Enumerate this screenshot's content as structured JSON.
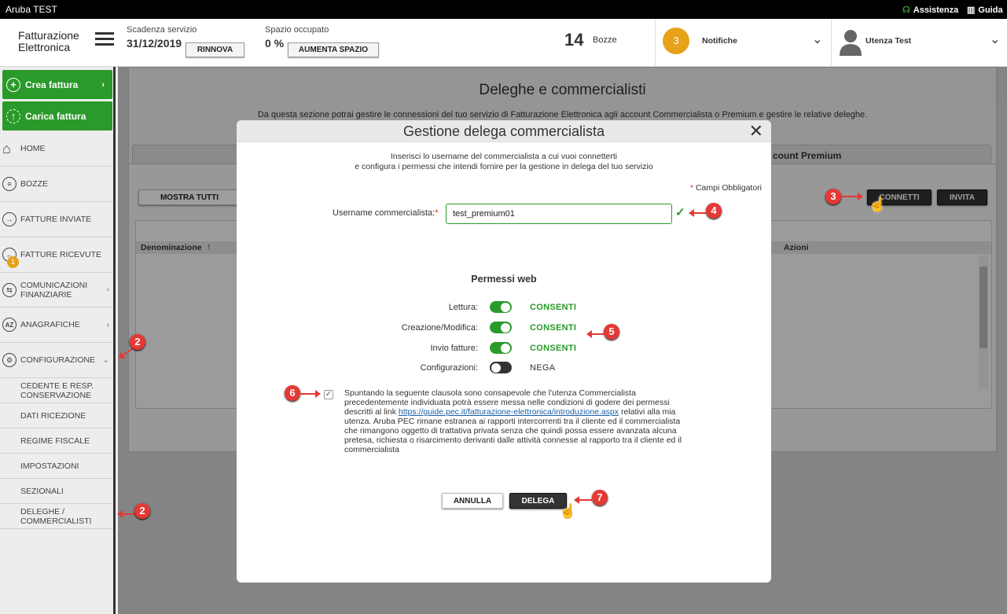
{
  "topbar": {
    "title": "Aruba TEST",
    "assistenza": "Assistenza",
    "guida": "Guida"
  },
  "header": {
    "logo_line1": "Fatturazione",
    "logo_line2": "Elettronica",
    "scadenza_label": "Scadenza servizio",
    "scadenza_value": "31/12/2019",
    "rinnova_label": "RINNOVA",
    "spazio_label": "Spazio occupato",
    "spazio_value": "0 %",
    "aumenta_label": "AUMENTA SPAZIO",
    "bozze_count": "14",
    "bozze_label": "Bozze",
    "notifiche_count": "3",
    "notifiche_label": "Notifiche",
    "user_label": "Utenza Test"
  },
  "sidebar": {
    "crea": "Crea fattura",
    "carica": "Carica fattura",
    "items": [
      {
        "label": "HOME"
      },
      {
        "label": "BOZZE"
      },
      {
        "label": "FATTURE INVIATE"
      },
      {
        "label": "FATTURE RICEVUTE",
        "badge": "1"
      },
      {
        "label": "COMUNICAZIONI FINANZIARIE"
      },
      {
        "label": "ANAGRAFICHE"
      },
      {
        "label": "CONFIGURAZIONE"
      }
    ],
    "subitems": [
      {
        "label": "CEDENTE E RESP. CONSERVAZIONE"
      },
      {
        "label": "DATI RICEZIONE"
      },
      {
        "label": "REGIME FISCALE"
      },
      {
        "label": "IMPOSTAZIONI"
      },
      {
        "label": "SEZIONALI"
      },
      {
        "label": "DELEGHE / COMMERCIALISTI"
      }
    ]
  },
  "page": {
    "title": "Deleghe e commercialisti",
    "description": "Da questa sezione potrai gestire le connessioni del tuo servizio di Fatturazione Elettronica agli account Commercialista o Premium e gestire le relative deleghe.",
    "tab_right": "count Premium",
    "mostra_tutti": "MOSTRA TUTTI",
    "connetti": "CONNETTI",
    "invita": "INVITA",
    "col_denominazione": "Denominazione",
    "col_azioni": "Azioni"
  },
  "modal": {
    "title": "Gestione delega commercialista",
    "intro1": "Inserisci lo username del commercialista a cui vuoi connetterti",
    "intro2": "e configura i permessi che intendi fornire per la gestione in delega del tuo servizio",
    "required_note": "Campi Obbligatori",
    "username_label": "Username commercialista:",
    "username_value": "test_premium01",
    "perm_title": "Permessi web",
    "permissions": [
      {
        "label": "Lettura:",
        "state": "CONSENTI",
        "on": true
      },
      {
        "label": "Creazione/Modifica:",
        "state": "CONSENTI",
        "on": true
      },
      {
        "label": "Invio fatture:",
        "state": "CONSENTI",
        "on": true
      },
      {
        "label": "Configurazioni:",
        "state": "NEGA",
        "on": false
      }
    ],
    "clause_part1": "Spuntando la seguente clausola sono consapevole che l'utenza Commercialista precedentemente individuata potrà essere messa nelle condizioni di godere dei permessi descritti al link ",
    "clause_link": "https://guide.pec.it/fatturazione-elettronica/introduzione.aspx",
    "clause_part2": " relativi alla mia utenza. Aruba PEC rimane estranea ai rapporti intercorrenti tra il cliente ed il commercialista che rimangono oggetto di trattativa privata senza che quindi possa essere avanzata alcuna pretesa, richiesta o risarcimento derivanti dalle attività connesse al rapporto tra il cliente ed il commercialista",
    "annulla": "ANNULLA",
    "delega": "DELEGA"
  },
  "colors": {
    "green": "#2a9a2a",
    "marker_red": "#e53935",
    "badge_orange": "#e8a21a"
  },
  "markers": {
    "m2a": "2",
    "m2b": "2",
    "m3": "3",
    "m4": "4",
    "m5": "5",
    "m6": "6",
    "m7": "7"
  }
}
